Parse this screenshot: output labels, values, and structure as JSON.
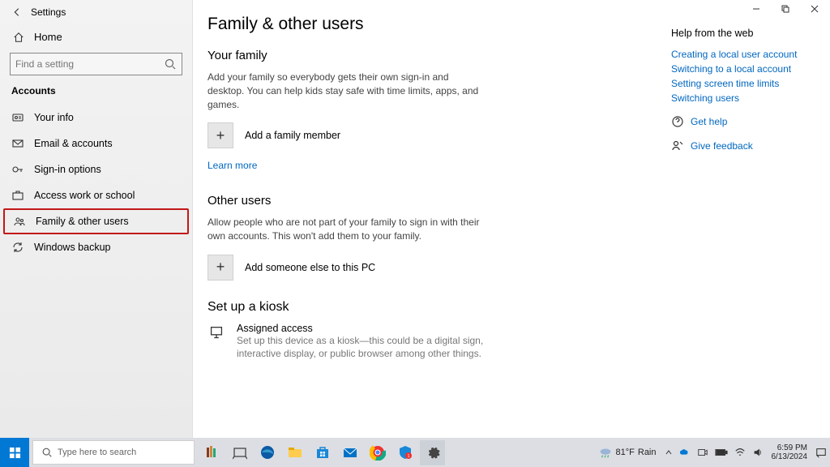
{
  "window": {
    "title": "Settings"
  },
  "sidebar": {
    "home": "Home",
    "search_placeholder": "Find a setting",
    "section": "Accounts",
    "items": [
      {
        "label": "Your info"
      },
      {
        "label": "Email & accounts"
      },
      {
        "label": "Sign-in options"
      },
      {
        "label": "Access work or school"
      },
      {
        "label": "Family & other users",
        "selected": true
      },
      {
        "label": "Windows backup"
      }
    ]
  },
  "page": {
    "title": "Family & other users",
    "family": {
      "heading": "Your family",
      "desc": "Add your family so everybody gets their own sign-in and desktop. You can help kids stay safe with time limits, apps, and games.",
      "add_label": "Add a family member",
      "learn_more": "Learn more"
    },
    "other": {
      "heading": "Other users",
      "desc": "Allow people who are not part of your family to sign in with their own accounts. This won't add them to your family.",
      "add_label": "Add someone else to this PC"
    },
    "kiosk": {
      "heading": "Set up a kiosk",
      "title": "Assigned access",
      "desc": "Set up this device as a kiosk—this could be a digital sign, interactive display, or public browser among other things."
    }
  },
  "help": {
    "title": "Help from the web",
    "links": [
      "Creating a local user account",
      "Switching to a local account",
      "Setting screen time limits",
      "Switching users"
    ],
    "get_help": "Get help",
    "feedback": "Give feedback"
  },
  "taskbar": {
    "search_placeholder": "Type here to search",
    "weather_temp": "81°F",
    "weather_cond": "Rain",
    "time": "6:59 PM",
    "date": "6/13/2024"
  }
}
